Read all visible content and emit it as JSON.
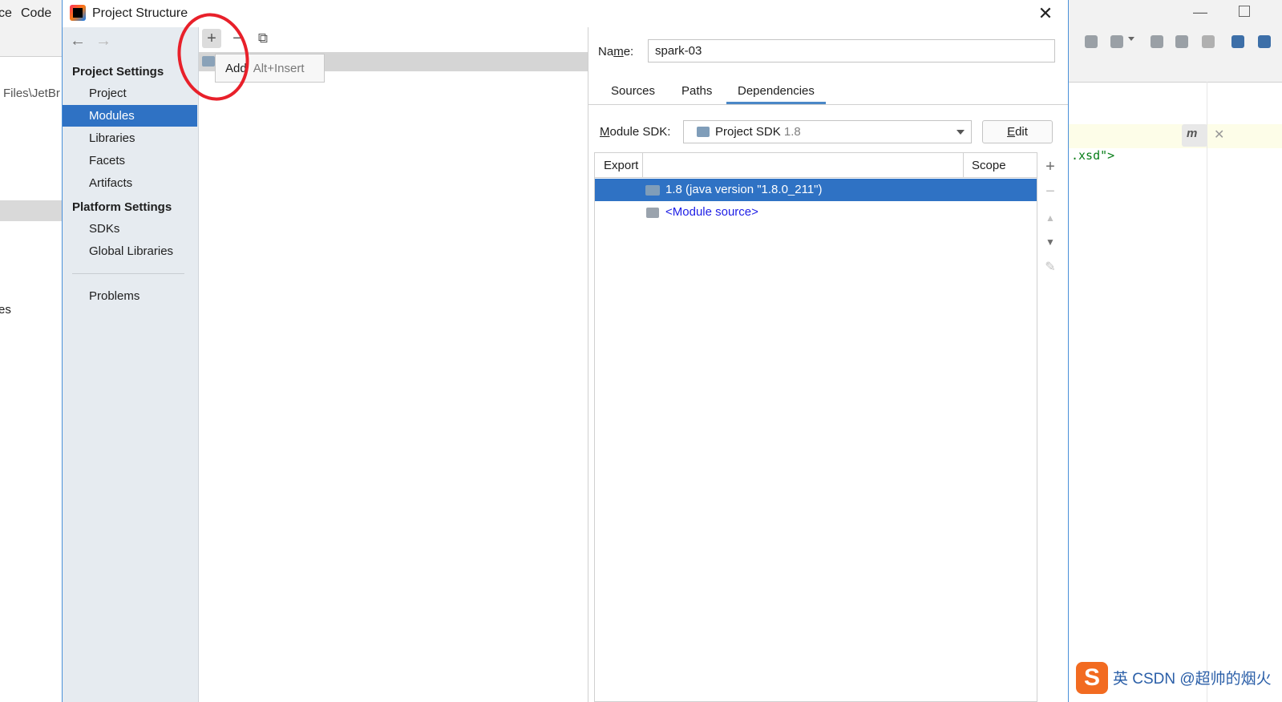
{
  "ide": {
    "menu": [
      "ce",
      "Code"
    ],
    "path_fragment": "Files\\JetBr",
    "side_fragment": "es",
    "code_fragment": ".xsd\">"
  },
  "dialog": {
    "title": "Project Structure",
    "close": "✕",
    "nav": {
      "back": "←",
      "forward": "→"
    },
    "sidebar": {
      "project_settings_heading": "Project Settings",
      "project_items": [
        "Project",
        "Modules",
        "Libraries",
        "Facets",
        "Artifacts"
      ],
      "selected": "Modules",
      "platform_settings_heading": "Platform Settings",
      "platform_items": [
        "SDKs",
        "Global Libraries"
      ],
      "problems": "Problems"
    },
    "middle": {
      "add_icon": "+",
      "remove_icon": "−",
      "copy_icon": "⧉",
      "tooltip_label": "Add",
      "tooltip_shortcut": "Alt+Insert"
    },
    "module": {
      "name_label_pre": "Na",
      "name_label_mnemonic": "m",
      "name_label_post": "e:",
      "name_value": "spark-03",
      "tabs": [
        "Sources",
        "Paths",
        "Dependencies"
      ],
      "active_tab": "Dependencies",
      "sdk_label_mnemonic": "M",
      "sdk_label_rest": "odule SDK:",
      "sdk_value": "Project SDK",
      "sdk_version": "1.8",
      "edit_button_mnemonic": "E",
      "edit_button_rest": "dit",
      "table": {
        "col_export": "Export",
        "col_scope": "Scope",
        "rows": [
          {
            "label": "1.8 (java version \"1.8.0_211\")",
            "selected": true
          },
          {
            "label": "<Module source>",
            "selected": false
          }
        ]
      },
      "side_tools": [
        "+",
        "−",
        "▲",
        "▼",
        "✎"
      ]
    }
  },
  "watermark": {
    "logo": "S",
    "text": "英 CSDN @超帅的烟火"
  },
  "colors": {
    "selection": "#2f72c4",
    "annotation_circle": "#e8202a",
    "link": "#2020e6"
  }
}
